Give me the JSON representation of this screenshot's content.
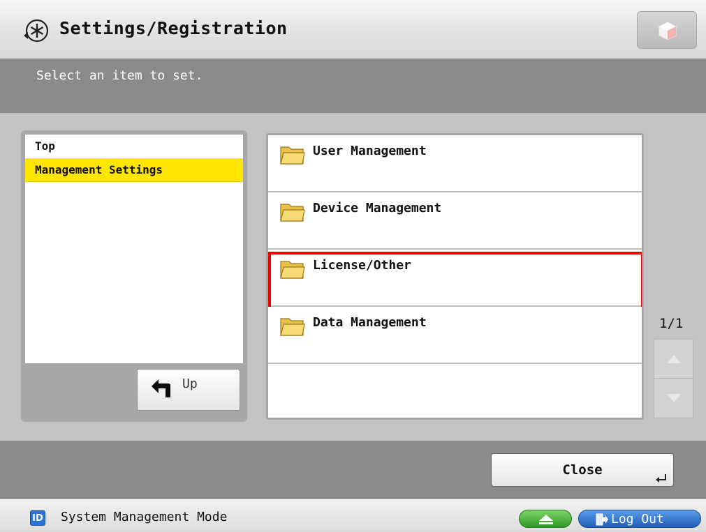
{
  "header": {
    "title": "Settings/Registration",
    "instruction": "Select an item to set."
  },
  "path_panel": {
    "items": [
      {
        "label": "Top",
        "selected": false
      },
      {
        "label": "Management Settings",
        "selected": true
      }
    ],
    "up_label": "Up"
  },
  "items": [
    {
      "label": "User Management",
      "highlighted": false
    },
    {
      "label": "Device Management",
      "highlighted": false
    },
    {
      "label": "License/Other",
      "highlighted": true
    },
    {
      "label": "Data Management",
      "highlighted": false
    }
  ],
  "pager": {
    "indicator": "1/1"
  },
  "footer": {
    "close_label": "Close"
  },
  "status": {
    "badge": "ID",
    "mode": "System Management Mode",
    "logout_label": "Log Out"
  },
  "colors": {
    "selected_row": "#ffe600",
    "highlight_border": "#ee0000",
    "folder": "#f5d45a",
    "logout_button": "#1f5fb8",
    "eject_button": "#2f9a22"
  },
  "icons": [
    "settings-icon",
    "device-status-icon",
    "up-arrow-icon",
    "folder-icon",
    "scroll-up-icon",
    "scroll-down-icon",
    "enter-icon",
    "id-icon",
    "eject-icon",
    "logout-icon"
  ]
}
